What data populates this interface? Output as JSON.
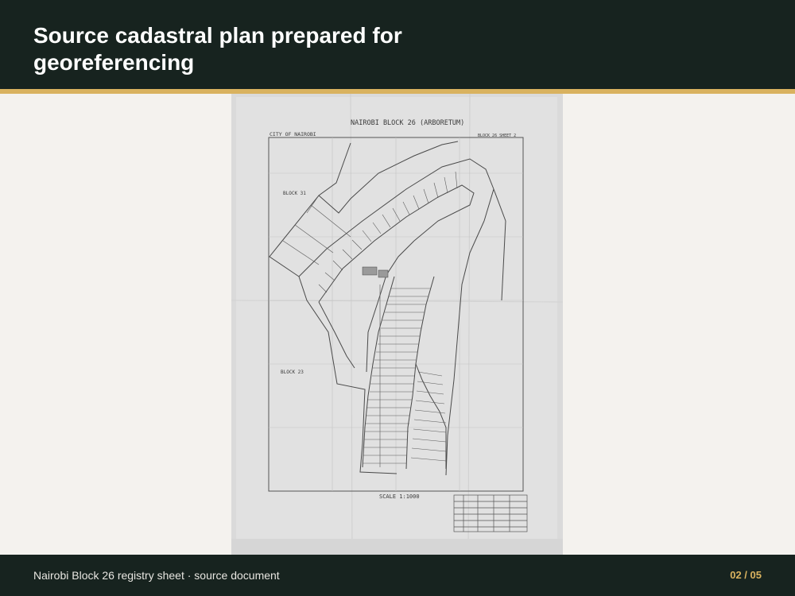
{
  "slide": {
    "title": "Source cadastral plan prepared for georeferencing",
    "caption": "Nairobi Block 26 registry sheet · source document",
    "page": "02 / 05"
  },
  "plan": {
    "heading": "NAIROBI  BLOCK 26  (ARBORETUM)",
    "city": "CITY OF NAIROBI",
    "block_upper": "BLOCK 31",
    "block_lower": "BLOCK 23",
    "sheet_ref": "BLOCK 26 SHEET 2",
    "scale": "SCALE  1:1000"
  },
  "colors": {
    "header_bg": "#17231f",
    "accent": "#d9b25f",
    "page_bg": "#f4f2ee"
  }
}
